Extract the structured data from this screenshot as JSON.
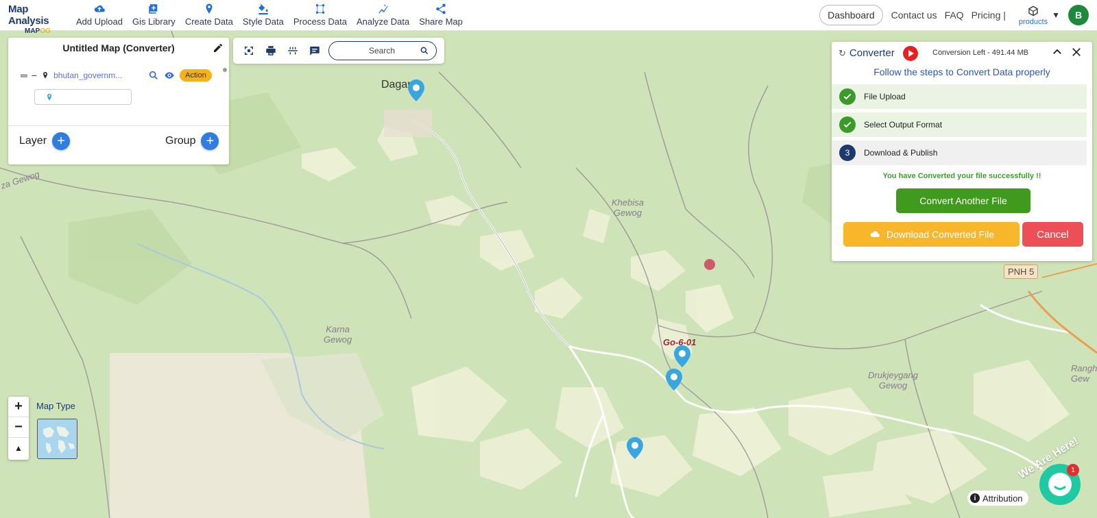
{
  "app": {
    "logo_title": "Map Analysis",
    "logo_sub_a": "MAP",
    "logo_sub_b": "OG"
  },
  "nav": {
    "items": [
      {
        "label": "Add Upload",
        "icon": "cloud-upload-icon"
      },
      {
        "label": "Gis Library",
        "icon": "library-icon"
      },
      {
        "label": "Create Data",
        "icon": "map-pin-icon"
      },
      {
        "label": "Style Data",
        "icon": "paint-bucket-icon"
      },
      {
        "label": "Process Data",
        "icon": "process-icon"
      },
      {
        "label": "Analyze Data",
        "icon": "analyze-icon"
      },
      {
        "label": "Share Map",
        "icon": "share-icon"
      }
    ],
    "dashboard": "Dashboard",
    "contact": "Contact us",
    "faq": "FAQ",
    "pricing": "Pricing |",
    "products": "products",
    "avatar": "B"
  },
  "layer_panel": {
    "title": "Untitled Map (Converter)",
    "layer_name": "bhutan_governm...",
    "action": "Action",
    "layer_label": "Layer",
    "group_label": "Group"
  },
  "toolbar": {
    "search_placeholder": "Search"
  },
  "converter": {
    "title": "Converter",
    "conversion_left": "Conversion Left - 491.44 MB",
    "subtitle": "Follow the steps to Convert Data properly",
    "steps": [
      {
        "label": "File Upload",
        "status": "done"
      },
      {
        "label": "Select Output Format",
        "status": "done"
      },
      {
        "label": "Download & Publish",
        "status": "current",
        "number": "3"
      }
    ],
    "success_msg": "You have Converted your file successfully !!",
    "convert_another": "Convert Another File",
    "download": "Download Converted File",
    "cancel": "Cancel"
  },
  "map": {
    "labels": {
      "darjeeling": "Dagana",
      "khebisa": "Khebisa\nGewog",
      "karna": "Karna\nGewog",
      "drukjeygang": "Drukjeygang\nGewog",
      "rangtho": "Ranghtho\nGew",
      "za_gewog": "za Gewog",
      "go_label": "Go-6-01",
      "road": "PNH 5"
    },
    "map_type_label": "Map Type",
    "zoom_in": "+",
    "zoom_out": "−",
    "compass": "▲",
    "attribution": "Attribution",
    "chat_badge": "1",
    "we_are_here": "We Are Here!"
  },
  "colors": {
    "brand_navy": "#1d3a6e",
    "accent_blue": "#1f6fd6",
    "success_green": "#3f9a1d",
    "download_yellow": "#f8b62b",
    "cancel_red": "#ec4f55",
    "map_green": "#cfe3b8"
  }
}
